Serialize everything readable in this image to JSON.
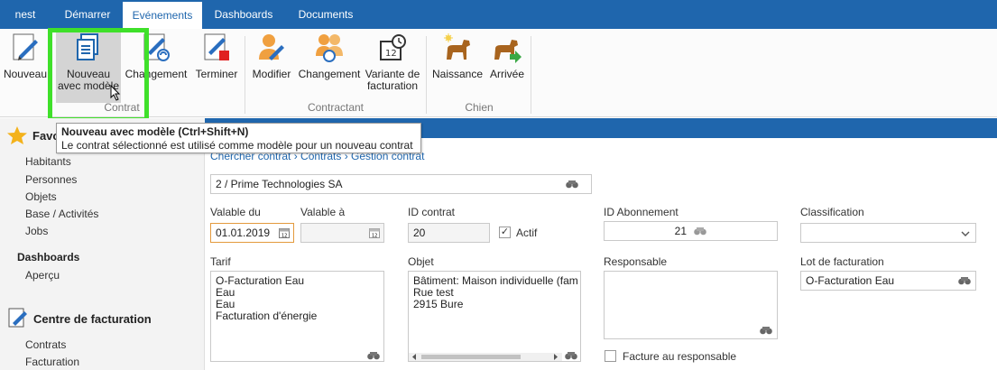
{
  "menubar": {
    "tabs": [
      {
        "label": "nest"
      },
      {
        "label": "Démarrer"
      },
      {
        "label": "Evénements"
      },
      {
        "label": "Dashboards"
      },
      {
        "label": "Documents"
      }
    ],
    "active_tab": "Evénements",
    "color": "#1f66ad"
  },
  "ribbon": {
    "buttons": {
      "nouveau": "Nouveau",
      "nouveau_modele_1": "Nouveau",
      "nouveau_modele_2": "avec modèle",
      "changement": "Changement",
      "terminer": "Terminer",
      "modifier": "Modifier",
      "changement2": "Changement",
      "variante_1": "Variante de",
      "variante_2": "facturation",
      "naissance": "Naissance",
      "arrivee": "Arrivée"
    },
    "groups": {
      "contrat": "Contrat",
      "contractant": "Contractant",
      "chien": "Chien"
    },
    "highlight_color": "#3fe02a"
  },
  "tooltip": {
    "title": "Nouveau avec modèle (Ctrl+Shift+N)",
    "text": "Le contrat sélectionné est utilisé comme modèle pour un nouveau contrat"
  },
  "sidebar": {
    "favorites_title": "Favo",
    "favorites": [
      "Habitants",
      "Personnes",
      "Objets",
      "Base / Activités",
      "Jobs"
    ],
    "dashboards_heading": "Dashboards",
    "dashboards": [
      "Aperçu"
    ],
    "billing_title": "Centre de facturation",
    "billing": [
      "Contrats",
      "Facturation"
    ]
  },
  "breadcrumb": "Chercher contrat  ›  Contrats  ›  Gestion contrat",
  "form": {
    "client": "2 / Prime Technologies SA",
    "valable_du_label": "Valable du",
    "valable_du": "01.01.2019",
    "valable_a_label": "Valable à",
    "valable_a": "",
    "id_contrat_label": "ID contrat",
    "id_contrat": "20",
    "actif_label": "Actif",
    "actif_checked": "✓",
    "id_abonnement_label": "ID Abonnement",
    "id_abonnement": "21",
    "classification_label": "Classification",
    "classification": "",
    "tarif_label": "Tarif",
    "tarif": [
      "O-Facturation Eau",
      "Eau",
      "Eau",
      "Facturation d'énergie"
    ],
    "objet_label": "Objet",
    "objet": [
      "Bâtiment: Maison individuelle (fam",
      "Rue test",
      "2915 Bure"
    ],
    "responsable_label": "Responsable",
    "responsable": "",
    "lot_label": "Lot de facturation",
    "lot": "O-Facturation Eau",
    "facture_resp_label": "Facture au responsable"
  }
}
